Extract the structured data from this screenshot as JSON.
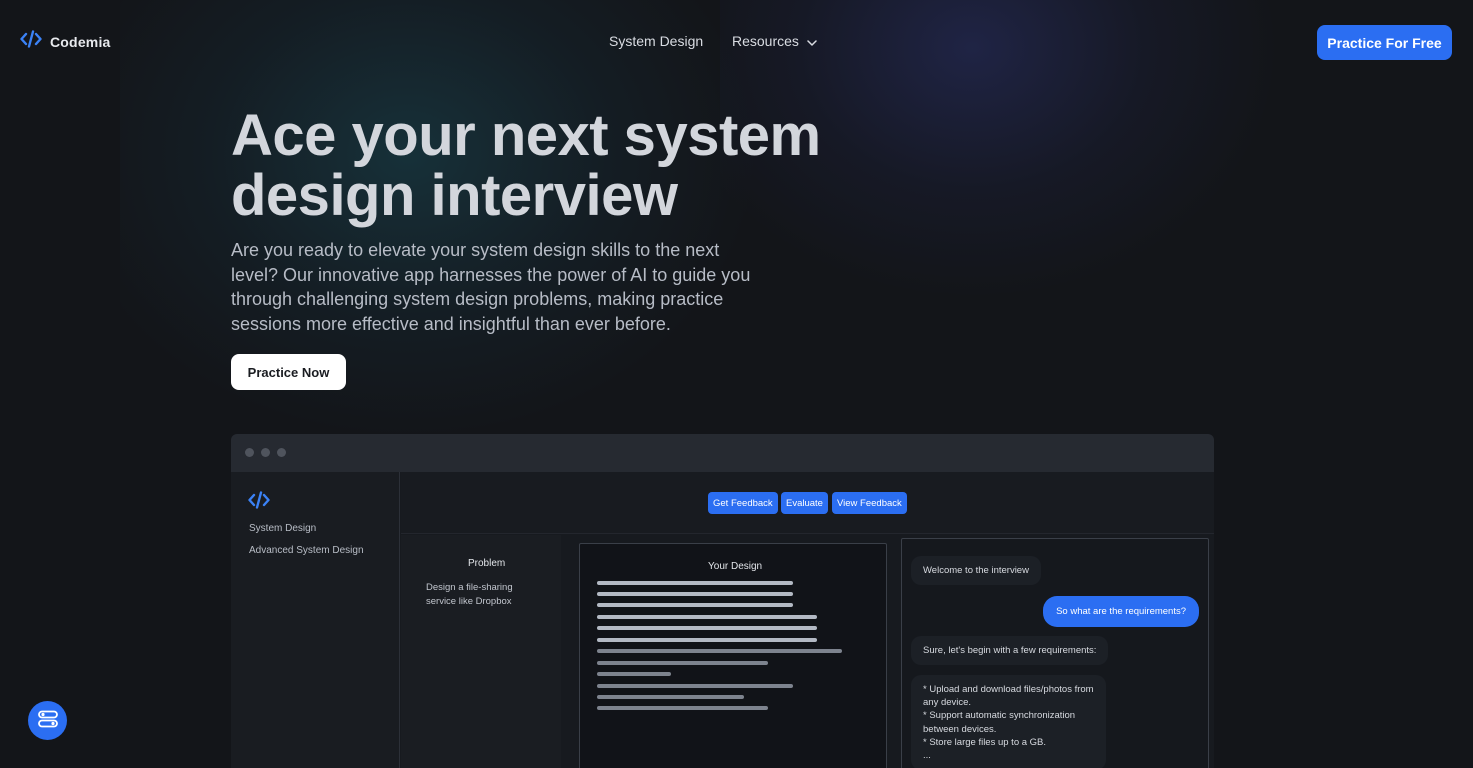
{
  "brand": {
    "name": "Codemia"
  },
  "nav": {
    "items": [
      {
        "label": "System Design"
      },
      {
        "label": "Resources"
      }
    ],
    "cta_label": "Practice For Free"
  },
  "hero": {
    "title_lines": [
      "Ace your next system",
      "design interview"
    ],
    "subtitle_lines": [
      "Are you ready to elevate your system design skills to the next",
      "level? Our innovative app harnesses the power of AI to guide you",
      "through challenging system design problems, making practice",
      "sessions more effective and insightful than ever before."
    ],
    "cta_label": "Practice Now"
  },
  "mockup": {
    "sidebar_items": [
      "System Design",
      "Advanced System Design"
    ],
    "actions": [
      "Get Feedback",
      "Evaluate",
      "View Feedback"
    ],
    "problem": {
      "title": "Problem",
      "text_lines": [
        "Design a file-sharing",
        "service like Dropbox"
      ]
    },
    "design": {
      "title": "Your Design"
    },
    "chat": {
      "welcome": "Welcome to the interview",
      "user_question": "So what are the requirements?",
      "reply": "Sure, let's begin with a few requirements:",
      "requirements_lines": [
        "* Upload and download files/photos from",
        "any device.",
        "* Support automatic synchronization",
        "between devices.",
        "* Store large files up to a GB.",
        "..."
      ]
    }
  },
  "colors": {
    "accent": "#2b6ef2",
    "background": "#131519"
  },
  "icons": {
    "logo": "code-brackets-icon",
    "dropdown": "chevron-down-icon",
    "fab": "toggle-settings-icon"
  }
}
